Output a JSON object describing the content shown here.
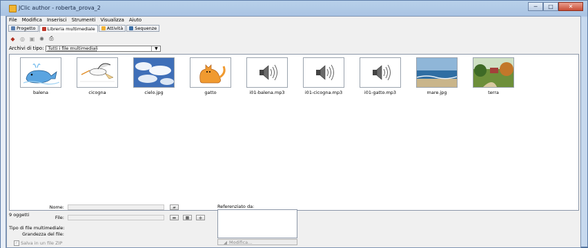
{
  "window": {
    "title": "JClic author - roberta_prova_2",
    "buttons": {
      "minimize": "─",
      "maximize": "□",
      "close": "✕"
    }
  },
  "menu": [
    "File",
    "Modifica",
    "Inserisci",
    "Strumenti",
    "Visualizza",
    "Aiuto"
  ],
  "tabs": [
    {
      "label": "Progetto",
      "icon": "project-icon",
      "color": "#5a7fb0"
    },
    {
      "label": "Libreria multimediale",
      "icon": "media-library-icon",
      "color": "#c0392b"
    },
    {
      "label": "Attività",
      "icon": "activity-icon",
      "color": "#f0b030"
    },
    {
      "label": "Sequenze",
      "icon": "sequence-icon",
      "color": "#3a6ea5"
    }
  ],
  "filter": {
    "label": "Archivi di tipo:",
    "value": "Tutti i file multimediali"
  },
  "media_items": [
    {
      "caption": "balena",
      "kind": "image"
    },
    {
      "caption": "cicogna",
      "kind": "image"
    },
    {
      "caption": "cielo.jpg",
      "kind": "image"
    },
    {
      "caption": "gatto",
      "kind": "image"
    },
    {
      "caption": "i01-balena.mp3",
      "kind": "audio"
    },
    {
      "caption": "i01-cicogna.mp3",
      "kind": "audio"
    },
    {
      "caption": "i01-gatto.mp3",
      "kind": "audio"
    },
    {
      "caption": "mare.jpg",
      "kind": "image"
    },
    {
      "caption": "terra",
      "kind": "image"
    }
  ],
  "status": "9 oggetti",
  "details": {
    "name_label": "Nome:",
    "file_label": "File:",
    "type_label": "Tipo di file multimediale:",
    "size_label": "Grandezza del file:",
    "zip_label": "Salva in un file ZIP",
    "referenced_label": "Referenziato da:",
    "modify_label": "Modifica..."
  }
}
